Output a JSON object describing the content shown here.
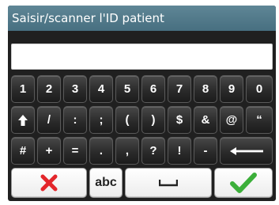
{
  "header": {
    "title": "Saisir/scanner l'ID patient"
  },
  "input": {
    "value": ""
  },
  "keyboard": {
    "row1": [
      "1",
      "2",
      "3",
      "4",
      "5",
      "6",
      "7",
      "8",
      "9",
      "0"
    ],
    "row2": [
      "/",
      ":",
      ";",
      "(",
      ")",
      "$",
      "&",
      "@",
      "“"
    ],
    "row3": [
      "#",
      "+",
      "=",
      ".",
      ",",
      "?",
      "!",
      "-"
    ],
    "abc_label": "abc",
    "icons": {
      "shift": "shift-arrow-icon",
      "backspace": "backspace-arrow-icon",
      "cancel": "red-x-icon",
      "space": "space-bar-icon",
      "confirm": "green-check-icon"
    }
  },
  "colors": {
    "header_bg": "#4f7787",
    "keyboard_bg": "#202020",
    "cancel_red": "#e3262b",
    "confirm_green": "#3caf3a"
  }
}
